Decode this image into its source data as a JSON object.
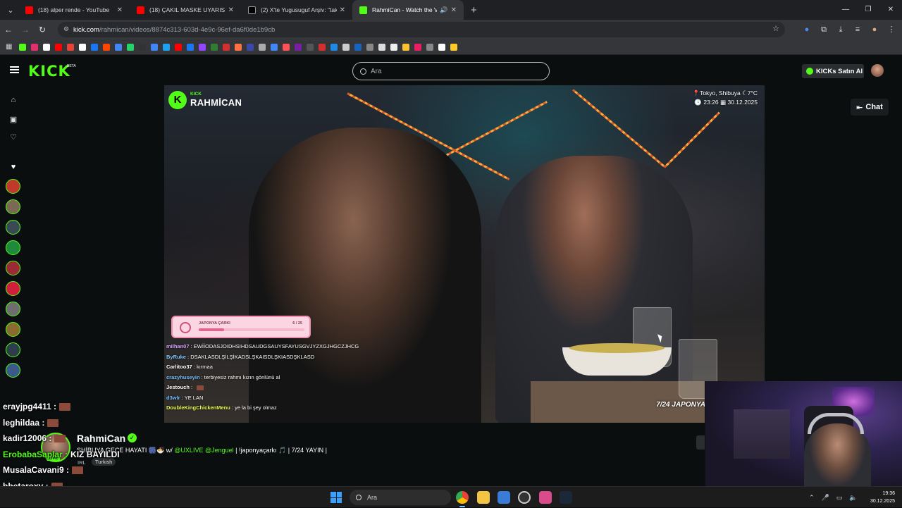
{
  "browser": {
    "tabs": [
      {
        "title": "(18) alper rende - YouTube",
        "color": "#ff0000"
      },
      {
        "title": "(18) ÇAKIL MASKE UYARISI VİR",
        "color": "#ff0000"
      },
      {
        "title": "(2) X'te Yugusuguf Arşiv: \"takla",
        "color": "#ffffff"
      },
      {
        "title": "RahmiCan - Watch the VOD",
        "color": "#53fc18"
      }
    ],
    "url_domain": "kick.com",
    "url_path": "/rahmican/videos/8874c313-603d-4e9c-96ef-da6f0de1b9cb",
    "bookmark_colors": [
      "#53fc18",
      "#e1306c",
      "#ffffff",
      "#ff0000",
      "#ea4335",
      "#ffffff",
      "#1877f2",
      "#ff4500",
      "#4285f4",
      "#25d366",
      "#333333",
      "#4285f4",
      "#1da1f2",
      "#ff0000",
      "#1877f2",
      "#9146ff",
      "#2e7d32",
      "#d32f2f",
      "#ff7043",
      "#3949ab",
      "#aaaaaa",
      "#4285f4",
      "#ff5252",
      "#7b1fa2",
      "#555555",
      "#d32f2f",
      "#1e88e5",
      "#cccccc",
      "#1565c0",
      "#888888",
      "#dddddd",
      "#eeeeee",
      "#fbc02d",
      "#e91e63",
      "#888888",
      "#ffffff",
      "#ffca28"
    ]
  },
  "kick": {
    "logo": "KICK",
    "beta": "BETA",
    "search_placeholder": "Ara",
    "buy_kicks": "KICKs Satın Al",
    "chat_button": "Chat"
  },
  "player": {
    "brand_tag": "KICK",
    "streamer_name": "RAHMİCAN",
    "location": "Tokyo, Shibuya",
    "temperature": "7°C",
    "time": "23:26",
    "date": "30.12.2025",
    "progress_label": "JAPONYA ÇARKI",
    "progress_count": "6 / 25",
    "progress_fraction": 0.24,
    "banner": "7/24 JAPONYA",
    "overlay_chat": [
      {
        "user": "mil​han07",
        "color": "#d9a3ff",
        "msg": "EWİİODASJOIDHSIHDSAUDGSAUYSFAYUSGVJYZXGJHGCZJHCG"
      },
      {
        "user": "ByRuke",
        "color": "#7ec8ff",
        "msg": "DSAKLASDLŞİLŞİKADSLŞKAISDLŞKIASDŞKLASD"
      },
      {
        "user": "Carlitoo37",
        "color": "#ffffff",
        "msg": "kırmaa"
      },
      {
        "user": "crazyhuseyin",
        "color": "#74c0ff",
        "msg": "terbiyesiz rahmı kızın gönlünü al"
      },
      {
        "user": "Jestouch",
        "color": "#ffffff",
        "msg": ""
      },
      {
        "user": "d3wlr",
        "color": "#74c0ff",
        "msg": "YE LAN"
      },
      {
        "user": "DoubleKingChickenMenu",
        "color": "#e6ff4d",
        "msg": "ye la bi şey olmaz"
      }
    ]
  },
  "stream_info": {
    "name": "RahmiCan",
    "live": "LIVE",
    "title_prefix": "SHİBUYA GECE HAYATI 🎆🍜 w/",
    "mention1": "@UXLIVE",
    "mention2": "@Jenguel",
    "title_suffix": "| !japonyaçarkı 🎵 | 7/24 YAYIN |",
    "category": "IRL",
    "language": "Turkish"
  },
  "big_chat": [
    {
      "user": "erayjpg4411 :",
      "color": "#ffffff",
      "msg": ""
    },
    {
      "user": "leghildaa :",
      "color": "#ffffff",
      "msg": ""
    },
    {
      "user": "kadir12006 :",
      "color": "#ffffff",
      "msg": ""
    },
    {
      "user": "ErobabaSaplar :",
      "color": "#53fc18",
      "msg": "KIZ BAYILDI"
    },
    {
      "user": "MusalaCavani9 :",
      "color": "#ffffff",
      "msg": ""
    },
    {
      "user": "bbetaroxy :",
      "color": "#ffffff",
      "msg": ""
    }
  ],
  "taskbar": {
    "search_placeholder": "Ara",
    "clock_time": "19:36",
    "clock_date": "30.12.2025"
  }
}
